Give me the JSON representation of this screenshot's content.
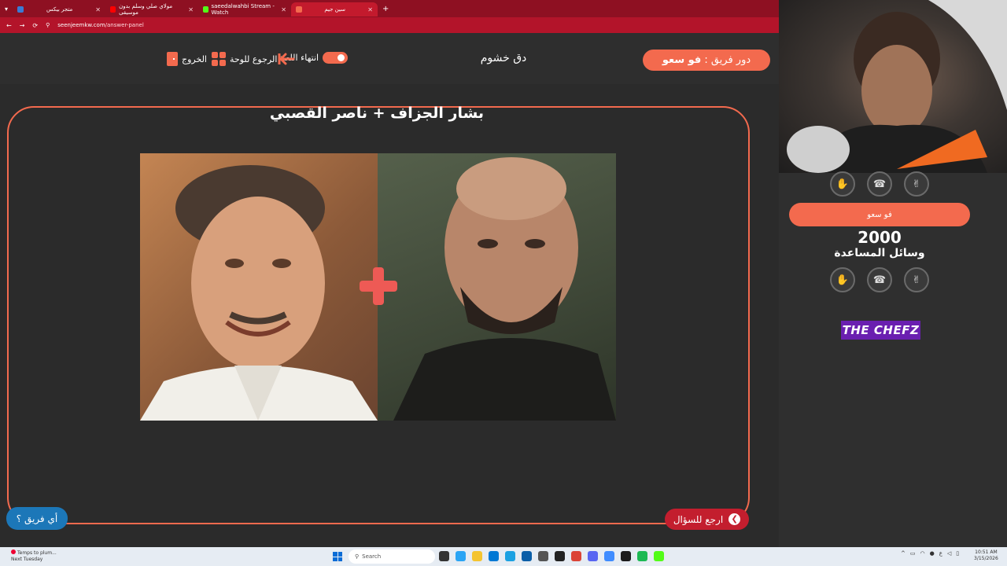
{
  "browser": {
    "tabs": [
      {
        "label": "متجر بيكس",
        "active": false
      },
      {
        "label": "مولاي صلي وسلم بدون موسيقى",
        "active": false
      },
      {
        "label": "saeedalwahbi Stream - Watch",
        "active": false
      },
      {
        "label": "سين جيم",
        "active": true
      }
    ],
    "add_tab": "+",
    "url_host": "seenjeemkw.com",
    "url_path": "/answer-panel"
  },
  "header": {
    "turn_prefix": "دور فريق :",
    "turn_team": "فو سعو",
    "category": "دق خشوم",
    "end_game_label": "انتهاء اللعبة",
    "back_to_board_label": "الرجوع للوحة",
    "exit_label": "الخروج"
  },
  "answer": {
    "title": "بشار الجزاف + ناصر القصبي"
  },
  "buttons": {
    "back_to_question": "ارجع للسؤال",
    "which_team": "أي فريق ؟"
  },
  "panel": {
    "team_name": "فو سعو",
    "score": "2000",
    "assists_label": "وسائل المساعدة",
    "logo_the": "THE",
    "logo_chefz": "CHEFZ"
  },
  "taskbar": {
    "weather_line1": "Temps to plum...",
    "weather_line2": "Next Tuesday",
    "search_placeholder": "Search",
    "clock_time": "10:51 AM",
    "clock_date": "3/15/2026"
  },
  "colors": {
    "accent": "#f36a4e",
    "tabbar": "#8e1022",
    "back_button": "#c31e2e",
    "which_team_button": "#1c77b8"
  }
}
